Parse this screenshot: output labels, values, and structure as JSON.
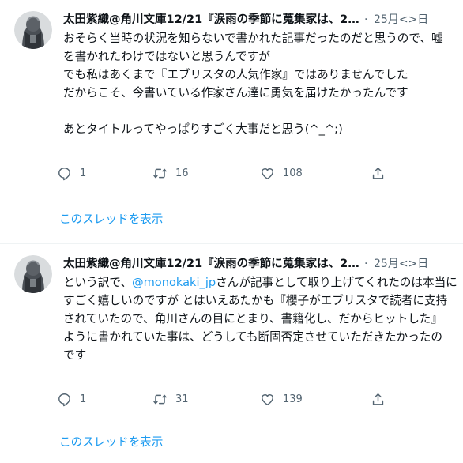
{
  "tweets": [
    {
      "author": "太田紫織@角川文庫12/21『涙雨の季節に蒐集家は、2…",
      "dot": "·",
      "time": "25月<>日",
      "lines": [
        "おそらく当時の状況を知らないで書かれた記事だったのだと思うので、嘘",
        "を書かれたわけではないと思うんですが",
        "でも私はあくまで『エブリスタの人気作家』ではありませんでした",
        "だからこそ、今書いている作家さん達に勇気を届けたかったんです",
        "",
        "あとタイトルってやっぱりすごく大事だと思う(^_^;)"
      ],
      "reply_count": "1",
      "retweet_count": "16",
      "like_count": "108",
      "thread_link": "このスレッドを表示"
    },
    {
      "author": "太田紫織@角川文庫12/21『涙雨の季節に蒐集家は、2…",
      "dot": "·",
      "time": "25月<>日",
      "line1_pre": "という訳で、",
      "mention": "@monokaki_jp",
      "line1_post": "さんが記事として取り上げてくれたのは本当に",
      "lines": [
        "すごく嬉しいのですが とはいえあたかも『櫻子がエブリスタで読者に支持",
        "されていたので、角川さんの目にとまり、書籍化し、だからヒットした』",
        "ように書かれていた事は、どうしても断固否定させていただきたかったの",
        "です"
      ],
      "reply_count": "1",
      "retweet_count": "31",
      "like_count": "139",
      "thread_link": "このスレッドを表示"
    }
  ],
  "icons": {
    "reply": "reply-icon",
    "retweet": "retweet-icon",
    "like": "like-icon",
    "share": "share-icon"
  }
}
